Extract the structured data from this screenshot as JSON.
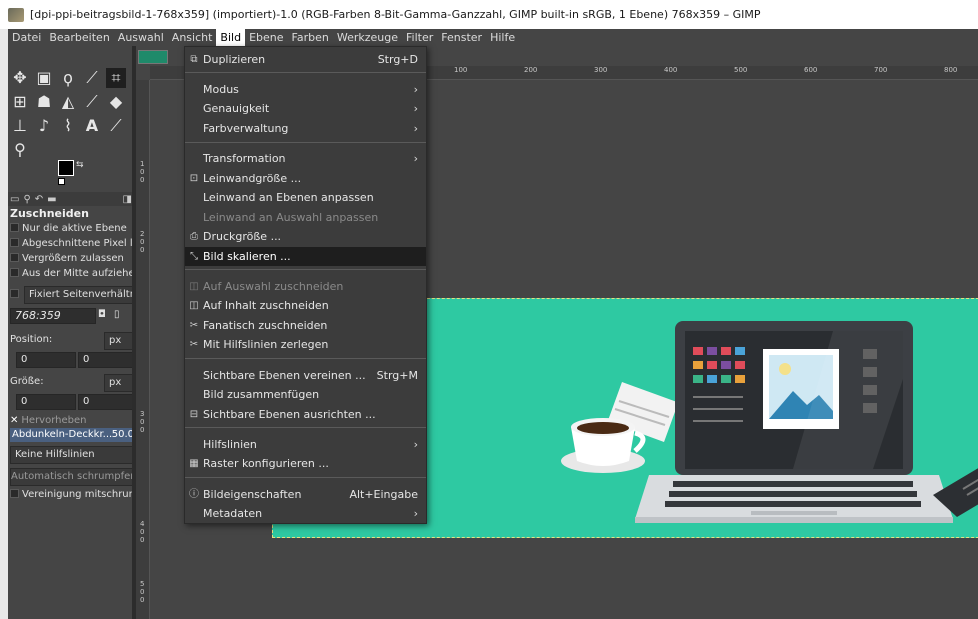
{
  "window": {
    "title": "[dpi-ppi-beitragsbild-1-768x359] (importiert)-1.0 (RGB-Farben 8-Bit-Gamma-Ganzzahl, GIMP built-in sRGB, 1 Ebene) 768x359 – GIMP"
  },
  "menubar": [
    "Datei",
    "Bearbeiten",
    "Auswahl",
    "Ansicht",
    "Bild",
    "Ebene",
    "Farben",
    "Werkzeuge",
    "Filter",
    "Fenster",
    "Hilfe"
  ],
  "toolbox": {
    "options_title": "Zuschneiden",
    "opt_active_layer": "Nur die aktive Ebene",
    "opt_delete_pixels": "Abgeschnittene Pixel lösch",
    "opt_allow_grow": "Vergrößern zulassen",
    "opt_from_center": "Aus der Mitte aufziehen",
    "fixed_label": "Fixiert  Seitenverhältnis",
    "aspect_value": "768:359",
    "position_label": "Position:",
    "position_unit": "px",
    "pos_x": "0",
    "pos_y": "0",
    "size_label": "Größe:",
    "size_unit": "px",
    "size_x": "0",
    "size_y": "0",
    "highlight_label": "Hervorheben",
    "darken_label": "Abdunkeln-Deckkr...",
    "darken_value": "50.0",
    "guides_value": "Keine Hilfslinien",
    "auto_shrink": "Automatisch schrumpfen",
    "merge_shrink": "Vereinigung mitschrumpfe"
  },
  "rulers": {
    "top": [
      "100",
      "200",
      "300",
      "400",
      "500",
      "600",
      "700",
      "800"
    ],
    "left": [
      "1",
      "0",
      "0",
      "2",
      "0",
      "0",
      "3",
      "0",
      "0",
      "4",
      "0",
      "0",
      "5",
      "0",
      "0"
    ]
  },
  "dropdown": {
    "items": [
      {
        "label": "Duplizieren",
        "shortcut": "Strg+D"
      },
      {
        "label": "Modus"
      },
      {
        "label": "Genauigkeit"
      },
      {
        "label": "Farbverwaltung"
      },
      {
        "label": "Transformation"
      },
      {
        "label": "Leinwandgröße ..."
      },
      {
        "label": "Leinwand an Ebenen anpassen"
      },
      {
        "label": "Leinwand an Auswahl anpassen"
      },
      {
        "label": "Druckgröße ..."
      },
      {
        "label": "Bild skalieren ..."
      },
      {
        "label": "Auf Auswahl zuschneiden"
      },
      {
        "label": "Auf Inhalt zuschneiden"
      },
      {
        "label": "Fanatisch zuschneiden"
      },
      {
        "label": "Mit Hilfslinien zerlegen"
      },
      {
        "label": "Sichtbare Ebenen vereinen ...",
        "shortcut": "Strg+M"
      },
      {
        "label": "Bild zusammenfügen"
      },
      {
        "label": "Sichtbare Ebenen ausrichten ..."
      },
      {
        "label": "Hilfslinien"
      },
      {
        "label": "Raster konfigurieren ..."
      },
      {
        "label": "Bildeigenschaften",
        "shortcut": "Alt+Eingabe"
      },
      {
        "label": "Metadaten"
      }
    ]
  },
  "colors": {
    "menubar_bg": "#454545",
    "canvas_teal": "#2ec9a2",
    "highlight": "#1e1e1e"
  }
}
